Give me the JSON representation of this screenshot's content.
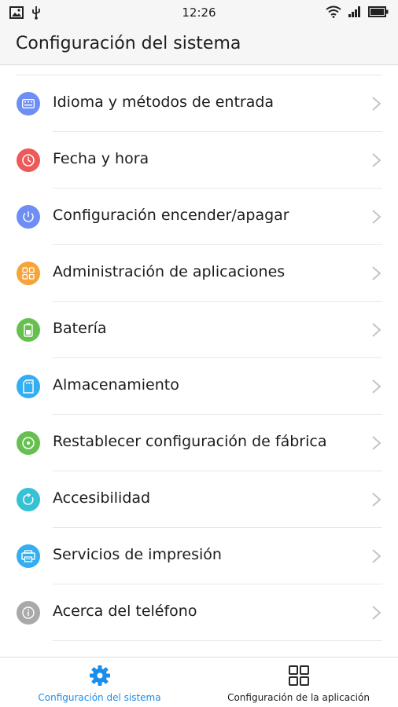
{
  "status_bar": {
    "time": "12:26"
  },
  "header": {
    "title": "Configuración del sistema"
  },
  "colors": {
    "accent": "#1b8dea",
    "keyboard": "#6f8ef3",
    "clock": "#ec5a5a",
    "power": "#6f8ef3",
    "apps": "#f6a33a",
    "battery": "#66c04f",
    "storage": "#33aef0",
    "reset": "#66c04f",
    "accessibility": "#36c2d4",
    "print": "#33aef0",
    "about": "#a9a9a9"
  },
  "settings": {
    "items": [
      {
        "label": "Idioma y métodos de entrada",
        "icon": "keyboard-icon"
      },
      {
        "label": "Fecha y hora",
        "icon": "clock-icon"
      },
      {
        "label": "Configuración encender/apagar",
        "icon": "power-icon"
      },
      {
        "label": "Administración de aplicaciones",
        "icon": "apps-grid-icon"
      },
      {
        "label": "Batería",
        "icon": "battery-icon"
      },
      {
        "label": "Almacenamiento",
        "icon": "sd-card-icon"
      },
      {
        "label": "Restablecer configuración de fábrica",
        "icon": "reset-icon"
      },
      {
        "label": "Accesibilidad",
        "icon": "accessibility-icon"
      },
      {
        "label": "Servicios de impresión",
        "icon": "printer-icon"
      },
      {
        "label": "Acerca del teléfono",
        "icon": "info-icon"
      }
    ]
  },
  "bottom_nav": {
    "tabs": [
      {
        "label": "Configuración del sistema",
        "icon": "gear-icon",
        "active": true
      },
      {
        "label": "Configuración de la aplicación",
        "icon": "grid-icon",
        "active": false
      }
    ]
  }
}
